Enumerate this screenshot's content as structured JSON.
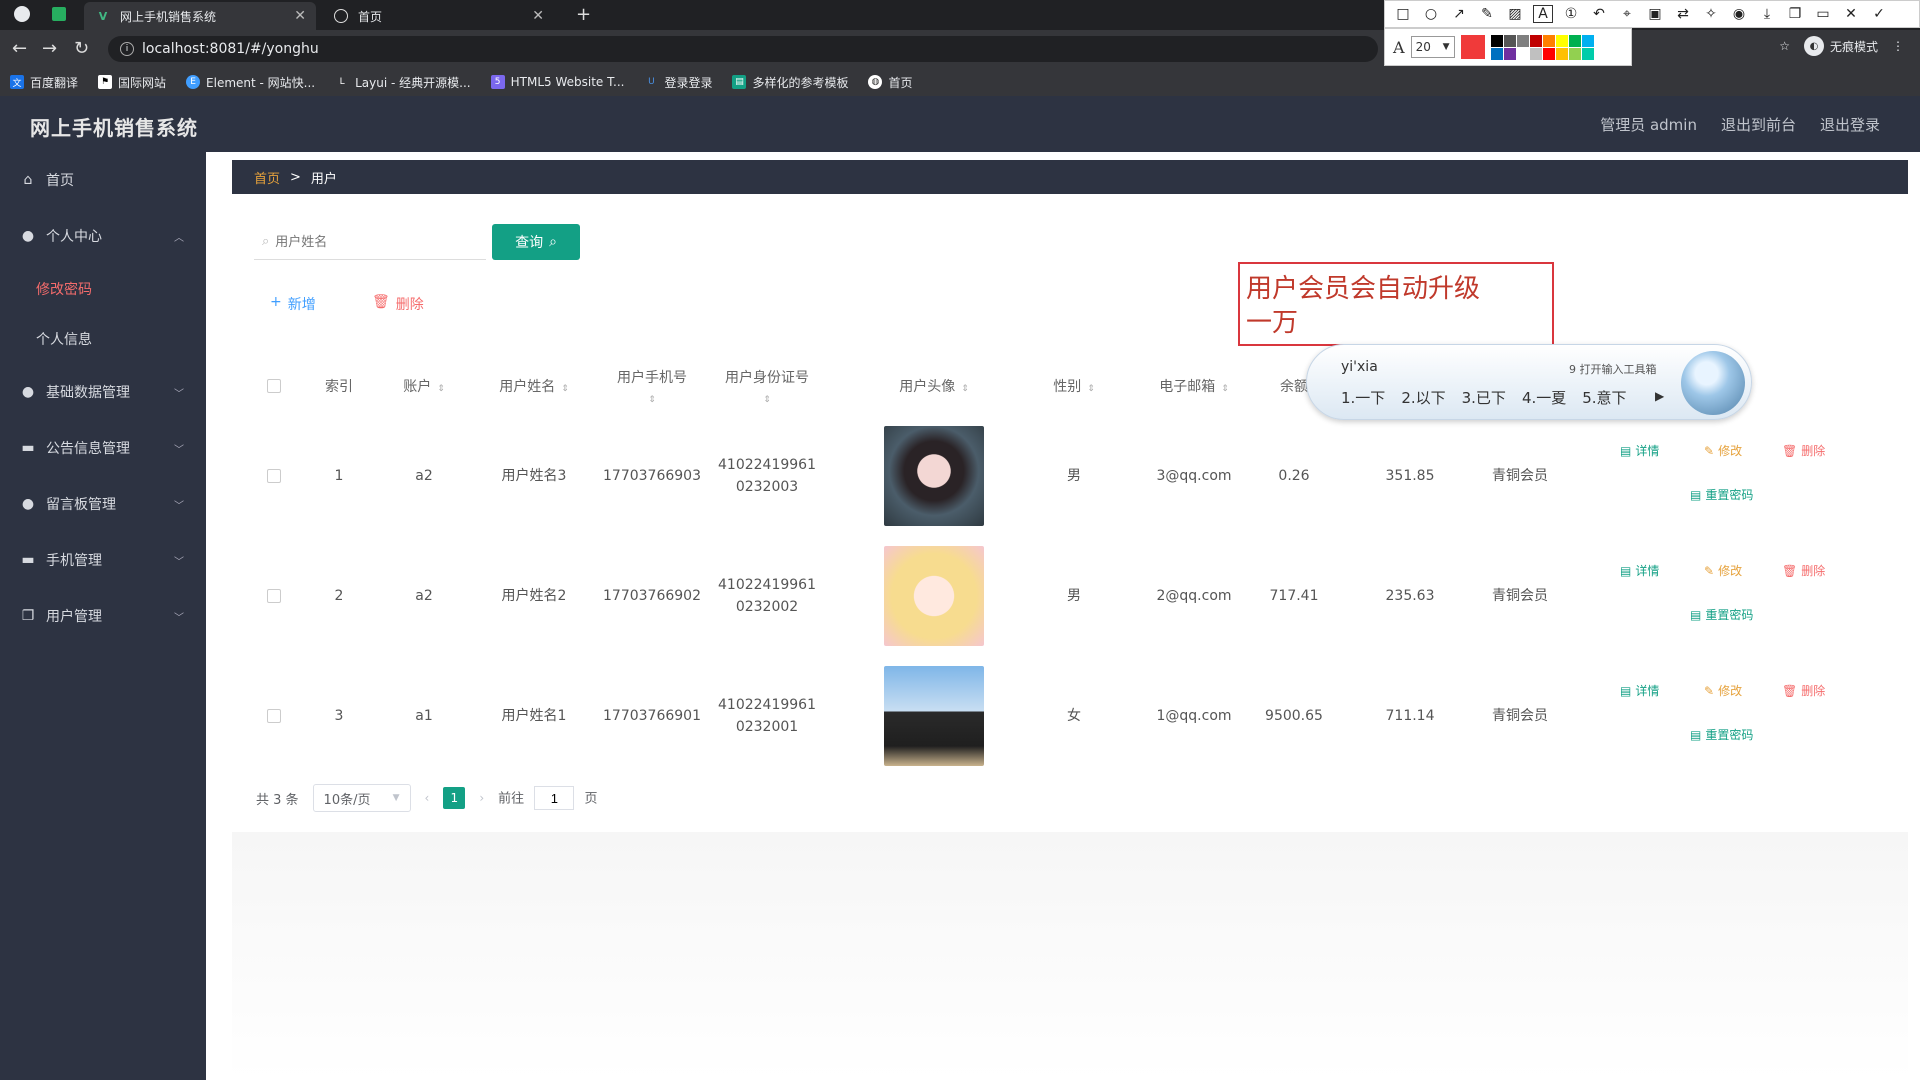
{
  "browser": {
    "tabs": [
      {
        "label": "网上手机销售系统",
        "active": true
      },
      {
        "label": "首页",
        "active": false
      }
    ],
    "url": "localhost:8081/#/yonghu",
    "bookmarks": [
      "百度翻译",
      "国际网站",
      "Element - 网站快...",
      "Layui - 经典开源模...",
      "HTML5 Website T...",
      "登录登录",
      "多样化的参考模板",
      "首页"
    ],
    "profile_label": "无痕模式"
  },
  "annotation_tool": {
    "font_size": "20",
    "active_color": "#f03a3a",
    "palette": [
      "#000000",
      "#555555",
      "#7f7f7f",
      "#c00000",
      "#ff8000",
      "#ffff00",
      "#00b050",
      "#00b0f0",
      "#0070c0",
      "#7030a0",
      "#ffffff",
      "#c0c0c0",
      "#ff0000",
      "#ffc000",
      "#92d050",
      "#00ccaa"
    ]
  },
  "app": {
    "title": "网上手机销售系统",
    "header_links": [
      "管理员 admin",
      "退出到前台",
      "退出登录"
    ]
  },
  "sidebar": {
    "items": [
      {
        "label": "首页",
        "icon": "home-icon",
        "expandable": false
      },
      {
        "label": "个人中心",
        "icon": "user-icon",
        "expandable": true,
        "expanded": true,
        "children": [
          {
            "label": "修改密码",
            "active": true
          },
          {
            "label": "个人信息",
            "active": false
          }
        ]
      },
      {
        "label": "基础数据管理",
        "icon": "user-icon",
        "expandable": true
      },
      {
        "label": "公告信息管理",
        "icon": "message-icon",
        "expandable": true
      },
      {
        "label": "留言板管理",
        "icon": "user-icon",
        "expandable": true
      },
      {
        "label": "手机管理",
        "icon": "phone-icon",
        "expandable": true
      },
      {
        "label": "用户管理",
        "icon": "copy-icon",
        "expandable": true
      }
    ]
  },
  "breadcrumb": {
    "home": "首页",
    "separator": ">",
    "current": "用户"
  },
  "search": {
    "placeholder": "用户姓名",
    "button": "查询"
  },
  "toolbar": {
    "add": "新增",
    "delete": "删除"
  },
  "table": {
    "columns": [
      "索引",
      "账户",
      "用户姓名",
      "用户手机号",
      "用户身份证号",
      "用户头像",
      "性别",
      "电子邮箱",
      "余额"
    ],
    "rows": [
      {
        "index": "1",
        "account": "a2",
        "name": "用户姓名3",
        "phone": "17703766903",
        "idcard_1": "41022419961",
        "idcard_2": "0232003",
        "gender": "男",
        "email": "3@qq.com",
        "balance": "0.26",
        "value2": "351.85",
        "level": "青铜会员"
      },
      {
        "index": "2",
        "account": "a2",
        "name": "用户姓名2",
        "phone": "17703766902",
        "idcard_1": "41022419961",
        "idcard_2": "0232002",
        "gender": "男",
        "email": "2@qq.com",
        "balance": "717.41",
        "value2": "235.63",
        "level": "青铜会员"
      },
      {
        "index": "3",
        "account": "a1",
        "name": "用户姓名1",
        "phone": "17703766901",
        "idcard_1": "41022419961",
        "idcard_2": "0232001",
        "gender": "女",
        "email": "1@qq.com",
        "balance": "9500.65",
        "value2": "711.14",
        "level": "青铜会员"
      }
    ],
    "actions": {
      "detail": "详情",
      "edit": "修改",
      "remove": "删除",
      "reset": "重置密码"
    }
  },
  "pagination": {
    "total": "共 3 条",
    "page_size": "10条/页",
    "current_page": "1",
    "goto_prefix": "前往",
    "goto_value": "1",
    "goto_suffix": "页"
  },
  "annotation_note": {
    "line1": "用户会员会自动升级",
    "line2": "一万"
  },
  "ime": {
    "input": "yi'xia",
    "hint": "9 打开输入工具箱",
    "candidates": [
      "1.一下",
      "2.以下",
      "3.已下",
      "4.一夏",
      "5.意下"
    ]
  }
}
